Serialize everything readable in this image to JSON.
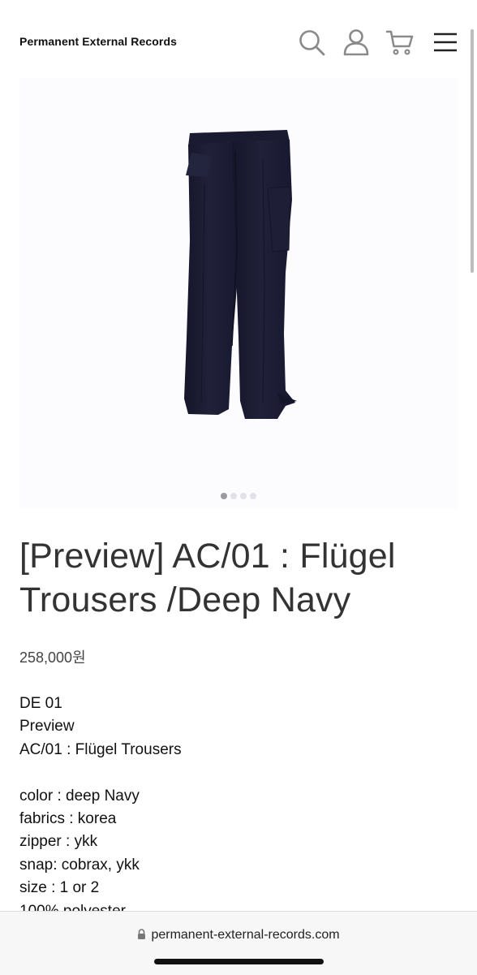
{
  "header": {
    "brand": "Permanent External Records",
    "icons": [
      "search-icon",
      "user-icon",
      "cart-icon",
      "menu-icon"
    ]
  },
  "gallery": {
    "slide_count": 4,
    "active_slide": 1
  },
  "product": {
    "title": "[Preview] AC/01 : Flügel Trousers /Deep Navy",
    "price": "258,000원",
    "description": [
      "DE 01",
      "Preview",
      "AC/01 : Flügel Trousers",
      "",
      "color : deep Navy",
      "fabrics : korea",
      "zipper : ykk",
      "snap: cobrax, ykk",
      "size : 1 or 2",
      "100% polyester"
    ]
  },
  "browser": {
    "url": "permanent-external-records.com"
  },
  "colors": {
    "trousers": "#1c1d33",
    "title_text": "#333333",
    "bottom_bar": "#f7f7f7"
  }
}
